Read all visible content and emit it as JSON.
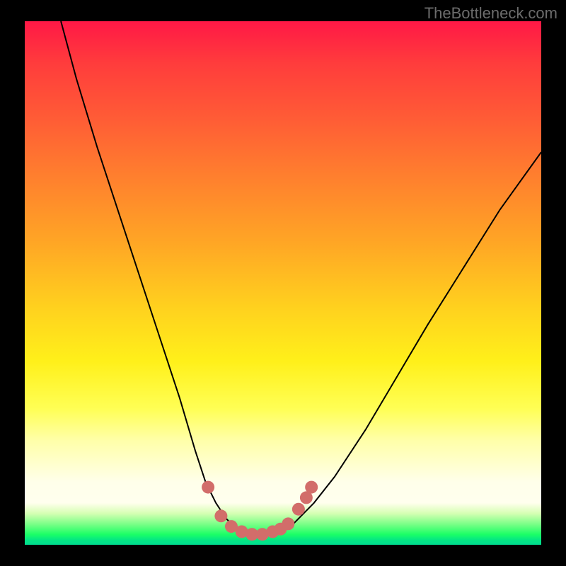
{
  "watermark": "TheBottleneck.com",
  "chart_data": {
    "type": "line",
    "title": "",
    "xlabel": "",
    "ylabel": "",
    "xlim": [
      0,
      100
    ],
    "ylim": [
      0,
      100
    ],
    "series": [
      {
        "name": "bottleneck-curve",
        "x": [
          7,
          10,
          14,
          18,
          22,
          26,
          30,
          33,
          35,
          37,
          39,
          41,
          43,
          45,
          48,
          52,
          56,
          60,
          66,
          72,
          78,
          85,
          92,
          100
        ],
        "y": [
          100,
          89,
          76,
          64,
          52,
          40,
          28,
          18,
          12,
          8,
          5,
          3,
          2,
          2,
          2,
          4,
          8,
          13,
          22,
          32,
          42,
          53,
          64,
          75
        ]
      }
    ],
    "markers": {
      "name": "highlight-dots",
      "color": "#d26d6a",
      "points": [
        {
          "x": 35.5,
          "y": 11
        },
        {
          "x": 38,
          "y": 5.5
        },
        {
          "x": 40,
          "y": 3.5
        },
        {
          "x": 42,
          "y": 2.5
        },
        {
          "x": 44,
          "y": 2
        },
        {
          "x": 46,
          "y": 2
        },
        {
          "x": 48,
          "y": 2.5
        },
        {
          "x": 49.5,
          "y": 3
        },
        {
          "x": 51,
          "y": 4
        },
        {
          "x": 53,
          "y": 6.8
        },
        {
          "x": 54.5,
          "y": 9
        },
        {
          "x": 55.5,
          "y": 11
        }
      ]
    }
  }
}
